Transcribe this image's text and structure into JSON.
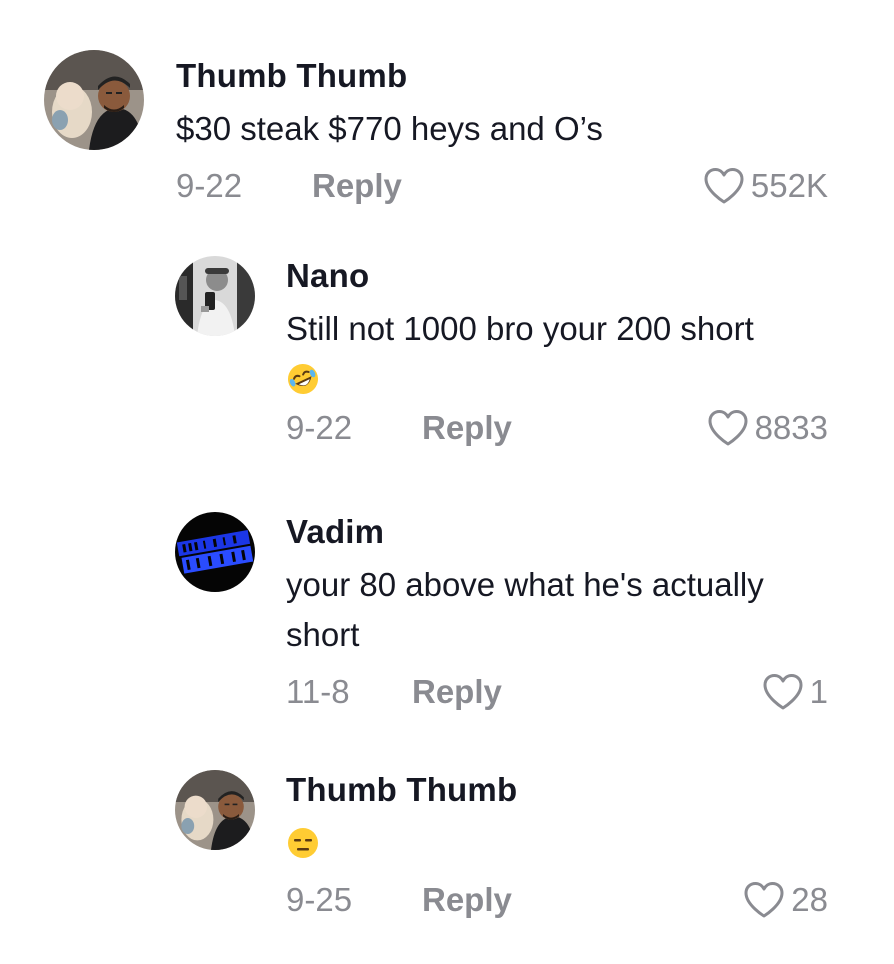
{
  "comments": [
    {
      "username": "Thumb Thumb",
      "text": "$30 steak $770 heys and O’s",
      "date": "9-22",
      "reply_label": "Reply",
      "likes": "552K",
      "avatar": "man-with-baby-photo"
    },
    {
      "username": "Nano",
      "text": "Still not 1000 bro your 200 short",
      "emoji": "rolling-on-floor-laughing",
      "date": "9-22",
      "reply_label": "Reply",
      "likes": "8833",
      "avatar": "mirror-selfie-photo"
    },
    {
      "username": "Vadim",
      "text": "your 80 above what he's actually short",
      "date": "11-8",
      "reply_label": "Reply",
      "likes": "1",
      "avatar": "not-of-this-earth-logo"
    },
    {
      "username": "Thumb Thumb",
      "emoji": "expressionless-face",
      "date": "9-25",
      "reply_label": "Reply",
      "likes": "28",
      "avatar": "man-with-baby-photo"
    }
  ],
  "colors": {
    "text": "#161823",
    "meta": "#8a8b91",
    "background": "#ffffff"
  }
}
